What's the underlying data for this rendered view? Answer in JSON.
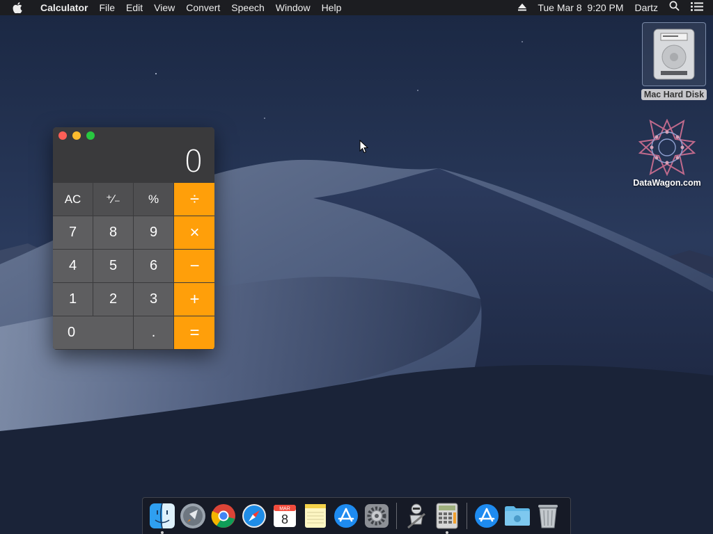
{
  "menubar": {
    "app_name": "Calculator",
    "menus": [
      "File",
      "Edit",
      "View",
      "Convert",
      "Speech",
      "Window",
      "Help"
    ],
    "clock": "Tue Mar 8  9:20 PM",
    "user": "Dartz"
  },
  "desktop": {
    "icons": [
      {
        "label": "Mac Hard Disk",
        "icon": "hard-disk-icon"
      },
      {
        "label": "DataWagon.com",
        "icon": "datawagon-logo-icon"
      }
    ]
  },
  "calculator": {
    "display_value": "0",
    "keys": {
      "ac": "AC",
      "sign": "⁺∕₋",
      "percent": "%",
      "divide": "÷",
      "seven": "7",
      "eight": "8",
      "nine": "9",
      "multiply": "×",
      "four": "4",
      "five": "5",
      "six": "6",
      "minus": "−",
      "one": "1",
      "two": "2",
      "three": "3",
      "plus": "+",
      "zero": "0",
      "decimal": ".",
      "equals": "="
    },
    "accent_color": "#ff9f0a"
  },
  "dock": {
    "items": [
      "Finder",
      "Launchpad",
      "Google Chrome",
      "Safari",
      "Calendar",
      "Notes",
      "App Store",
      "System Preferences",
      "Automator",
      "Calculator",
      "App Store",
      "Downloads",
      "Trash"
    ],
    "calendar": {
      "month": "MAR",
      "day": "8"
    }
  }
}
